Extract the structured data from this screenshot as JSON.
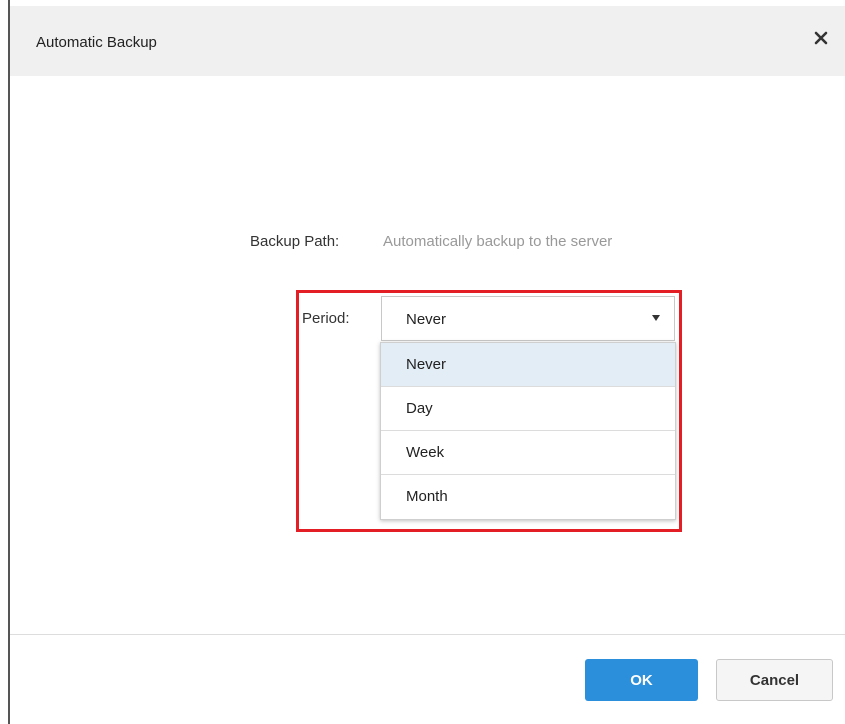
{
  "dialog": {
    "title": "Automatic Backup",
    "close_icon": "close-icon"
  },
  "backup_path": {
    "label": "Backup Path:",
    "value": "Automatically backup to the server"
  },
  "period": {
    "label": "Period:",
    "selected": "Never",
    "options": [
      "Never",
      "Day",
      "Week",
      "Month"
    ],
    "highlight_color": "#e31e24"
  },
  "buttons": {
    "ok_label": "OK",
    "cancel_label": "Cancel",
    "ok_color": "#2b8fdb"
  }
}
